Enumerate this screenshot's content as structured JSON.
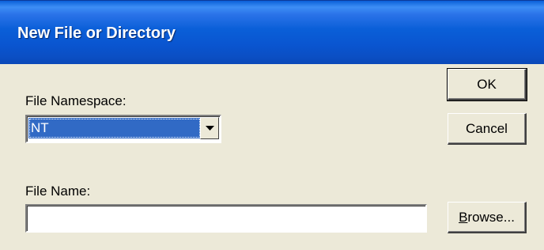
{
  "window": {
    "title": "New File or Directory"
  },
  "namespace": {
    "label": "File Namespace:",
    "selected": "NT"
  },
  "filename": {
    "label": "File Name:",
    "value": "",
    "placeholder": ""
  },
  "buttons": {
    "ok_label": "OK",
    "cancel_label": "Cancel",
    "browse_mnemonic": "B",
    "browse_rest": "rowse..."
  },
  "icons": {
    "dropdown": "chevron-down-icon"
  },
  "colors": {
    "titlebar": "#0a5fd8",
    "selection": "#316ac5",
    "face": "#ece9d8"
  }
}
